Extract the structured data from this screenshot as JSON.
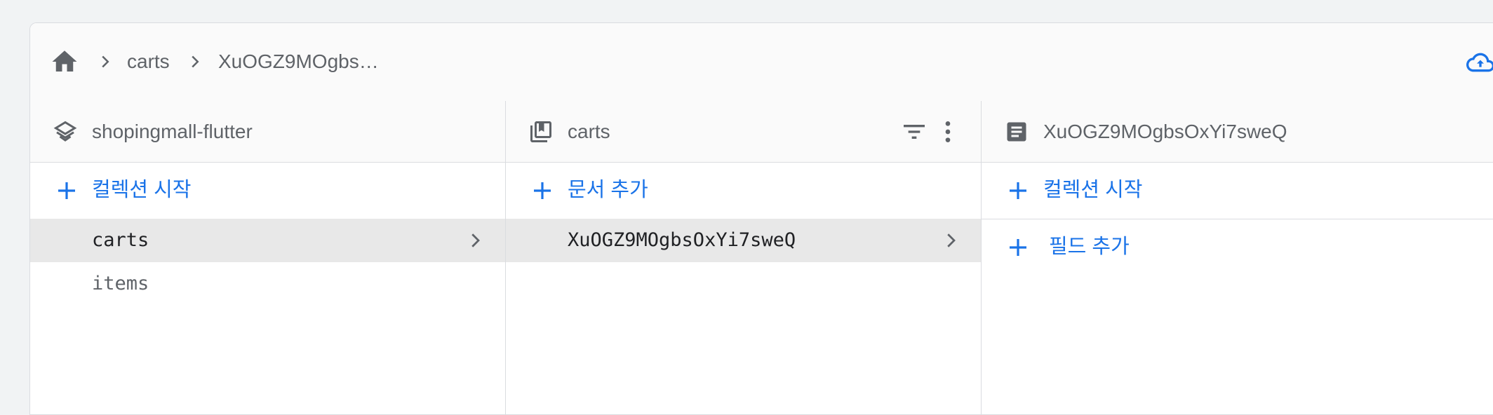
{
  "breadcrumb": {
    "home_icon": "home-icon",
    "items": [
      "carts",
      "XuOGZ9MOgbs…"
    ],
    "cloud_icon": "cloud-sync-icon"
  },
  "columns": {
    "root": {
      "title": "shopingmall-flutter",
      "icon": "layers-icon",
      "action_label": "컬렉션 시작",
      "items": [
        "carts",
        "items"
      ]
    },
    "collection": {
      "title": "carts",
      "icon": "collection-icon",
      "action_label": "문서 추가",
      "items": [
        "XuOGZ9MOgbsOxYi7sweQ"
      ]
    },
    "document": {
      "title": "XuOGZ9MOgbsOxYi7sweQ",
      "icon": "document-icon",
      "action_label": "컬렉션 시작",
      "add_field_label": "필드 추가"
    }
  },
  "colors": {
    "accent": "#1a73e8",
    "selected_row": "#e8e8e8",
    "border": "#dadce0"
  }
}
